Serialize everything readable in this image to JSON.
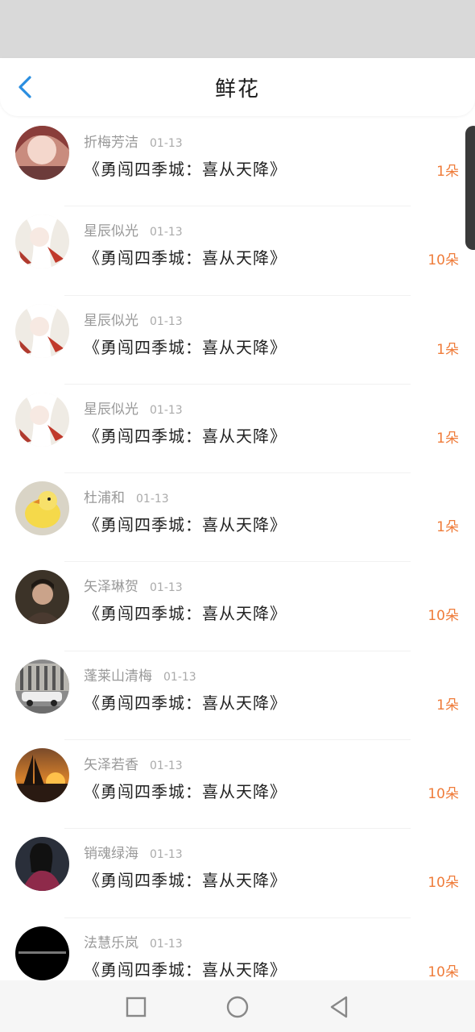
{
  "header": {
    "title": "鲜花",
    "back_icon": "chevron-left-icon",
    "accent": "#2a8ee0"
  },
  "colors": {
    "count": "#ef7c3a",
    "name": "#999999",
    "title": "#1a1a1a"
  },
  "items": [
    {
      "user": "折梅芳洁",
      "date": "01-13",
      "book": "《勇闯四季城：喜从天降》",
      "count": "1朵"
    },
    {
      "user": "星辰似光",
      "date": "01-13",
      "book": "《勇闯四季城：喜从天降》",
      "count": "10朵"
    },
    {
      "user": "星辰似光",
      "date": "01-13",
      "book": "《勇闯四季城：喜从天降》",
      "count": "1朵"
    },
    {
      "user": "星辰似光",
      "date": "01-13",
      "book": "《勇闯四季城：喜从天降》",
      "count": "1朵"
    },
    {
      "user": "杜浦和",
      "date": "01-13",
      "book": "《勇闯四季城：喜从天降》",
      "count": "1朵"
    },
    {
      "user": "矢泽琳贺",
      "date": "01-13",
      "book": "《勇闯四季城：喜从天降》",
      "count": "10朵"
    },
    {
      "user": "蓬莱山清梅",
      "date": "01-13",
      "book": "《勇闯四季城：喜从天降》",
      "count": "1朵"
    },
    {
      "user": "矢泽若香",
      "date": "01-13",
      "book": "《勇闯四季城：喜从天降》",
      "count": "10朵"
    },
    {
      "user": "销魂绿海",
      "date": "01-13",
      "book": "《勇闯四季城：喜从天降》",
      "count": "10朵"
    },
    {
      "user": "法慧乐岚",
      "date": "01-13",
      "book": "《勇闯四季城：喜从天降》",
      "count": "10朵"
    }
  ],
  "nav": {
    "recent": "square-icon",
    "home": "circle-icon",
    "back": "triangle-back-icon"
  }
}
